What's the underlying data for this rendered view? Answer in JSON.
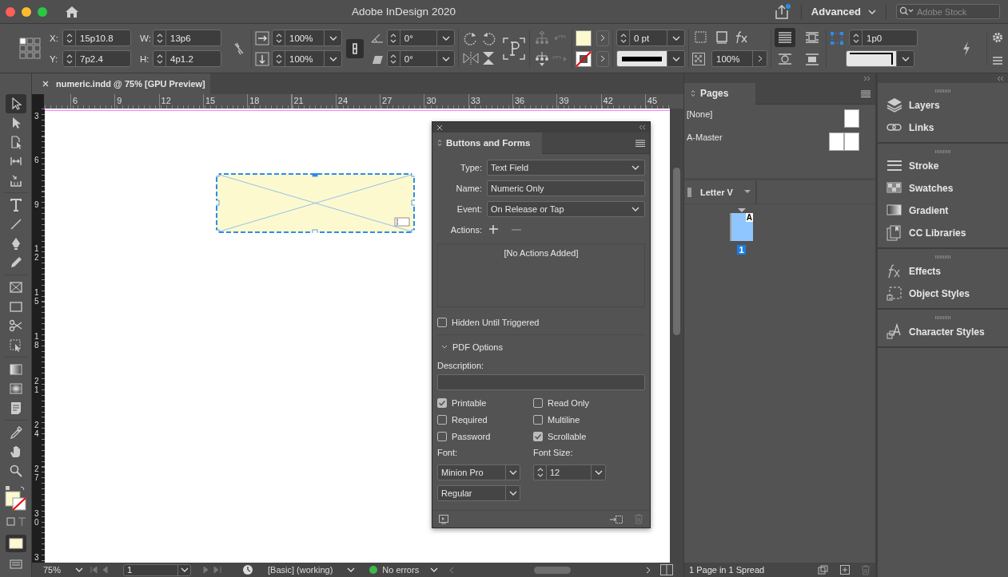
{
  "window": {
    "title": "Adobe InDesign 2020"
  },
  "workspace": {
    "label": "Advanced"
  },
  "search": {
    "placeholder": "Adobe Stock"
  },
  "control_bar": {
    "position": [
      {
        "label": "X:",
        "value": "15p10.8"
      },
      {
        "label": "Y:",
        "value": "7p2.4"
      }
    ],
    "size": [
      {
        "label": "W:",
        "value": "13p6"
      },
      {
        "label": "H:",
        "value": "4p1.2"
      }
    ],
    "size_linked": false,
    "scale": [
      "100%",
      "100%"
    ],
    "scale_linked": true,
    "angles": [
      "0°",
      "0°"
    ],
    "stroke_weight": "0 pt",
    "opacity": "100%",
    "wrap_options": [
      {
        "kind": "nowrap",
        "selected": true
      },
      {
        "kind": "box",
        "selected": false
      },
      {
        "kind": "shape",
        "selected": false
      },
      {
        "kind": "jump",
        "selected": false
      }
    ],
    "fitting_offset": "1p0"
  },
  "document_tab": {
    "title": "numeric.indd @ 75% [GPU Preview]"
  },
  "tools": [
    {
      "kind": "select",
      "selected": true
    },
    {
      "kind": "direct",
      "selected": false
    },
    {
      "kind": "page",
      "selected": false
    },
    {
      "kind": "gap",
      "selected": false
    },
    {
      "kind": "collector",
      "selected": false
    },
    {
      "kind": "type",
      "selected": false
    },
    {
      "kind": "line",
      "selected": false
    },
    {
      "kind": "pen",
      "selected": false
    },
    {
      "kind": "pencil",
      "selected": false
    },
    {
      "kind": "frame",
      "selected": false
    },
    {
      "kind": "rectangle",
      "selected": false
    },
    {
      "kind": "scissors",
      "selected": false
    },
    {
      "kind": "transform",
      "selected": false
    },
    {
      "kind": "gradient",
      "selected": false
    },
    {
      "kind": "feather",
      "selected": false
    },
    {
      "kind": "note",
      "selected": false
    },
    {
      "kind": "eyedropper",
      "selected": false
    },
    {
      "kind": "hand",
      "selected": false
    },
    {
      "kind": "zoom",
      "selected": false
    }
  ],
  "rulers": {
    "horizontal": [
      "6",
      "9",
      "12",
      "15",
      "18",
      "21",
      "24",
      "27",
      "30",
      "33",
      "36",
      "39",
      "42",
      "45"
    ],
    "vertical": [
      "3",
      "6",
      "9",
      "12",
      "15",
      "18",
      "21",
      "24",
      "27",
      "30",
      "3"
    ]
  },
  "buttons_and_forms": {
    "title": "Buttons and Forms",
    "fields": [
      {
        "label": "Type:",
        "value": "Text Field",
        "kind": "dropdown"
      },
      {
        "label": "Name:",
        "value": "Numeric Only",
        "kind": "text"
      },
      {
        "label": "Event:",
        "value": "On Release or Tap",
        "kind": "dropdown"
      }
    ],
    "actions_label": "Actions:",
    "actions_empty": "[No Actions Added]",
    "hidden_until_triggered": {
      "label": "Hidden Until Triggered",
      "checked": false
    },
    "pdf_options": {
      "label": "PDF Options",
      "expanded": true
    },
    "description_label": "Description:",
    "options": [
      {
        "label": "Printable",
        "checked": true
      },
      {
        "label": "Read Only",
        "checked": false
      },
      {
        "label": "Required",
        "checked": false
      },
      {
        "label": "Multiline",
        "checked": false
      },
      {
        "label": "Password",
        "checked": false
      },
      {
        "label": "Scrollable",
        "checked": true
      }
    ],
    "font_label": "Font:",
    "font": "Minion Pro",
    "font_style": "Regular",
    "font_size_label": "Font Size:",
    "font_size": "12"
  },
  "pages_panel": {
    "title": "Pages",
    "masters": [
      {
        "name": "[None]",
        "kind": "single"
      },
      {
        "name": "A-Master",
        "kind": "spread"
      }
    ],
    "page_size": "Letter V",
    "pages": [
      {
        "number": "1",
        "master": "A",
        "selected": true
      }
    ],
    "summary": "1 Page in 1 Spread"
  },
  "dock": [
    [
      {
        "label": "Layers",
        "kind": "layers"
      },
      {
        "label": "Links",
        "kind": "links"
      }
    ],
    [
      {
        "label": "Stroke",
        "kind": "stroke"
      },
      {
        "label": "Swatches",
        "kind": "swatches"
      },
      {
        "label": "Gradient",
        "kind": "gradient"
      },
      {
        "label": "CC Libraries",
        "kind": "libraries"
      }
    ],
    [
      {
        "label": "Effects",
        "kind": "effects"
      },
      {
        "label": "Object Styles",
        "kind": "objectstyles"
      }
    ],
    [
      {
        "label": "Character Styles",
        "kind": "charstyles"
      }
    ]
  ],
  "status_bar": {
    "zoom": "75%",
    "page": "1",
    "preflight_profile": "[Basic] (working)",
    "preflight_status": "No errors",
    "preflight_ok": true
  }
}
